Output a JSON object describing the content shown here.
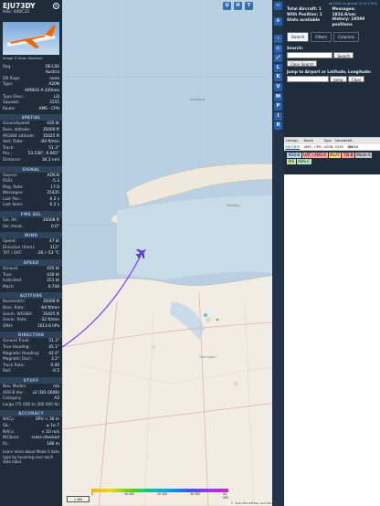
{
  "aircraft": {
    "callsign": "EJU73DY",
    "hex_line": "Hex: 440C33",
    "photo_credit": "Image © Brian Stoeman",
    "top_fields": [
      {
        "k": "Reg.:",
        "v": "OE-LSE"
      },
      {
        "k": "",
        "v": "Austria"
      },
      {
        "k": "DB flags:",
        "v": "none"
      },
      {
        "k": "Type:",
        "v": "A20N"
      },
      {
        "k": "",
        "v": "AIRBUS A-320neo"
      },
      {
        "k": "Type Desc.:",
        "v": "L2J"
      },
      {
        "k": "Squawk:",
        "v": "3155"
      },
      {
        "k": "Route:",
        "v": "AMS - CPH"
      }
    ],
    "sections": [
      {
        "title": "SPATIAL",
        "rows": [
          {
            "k": "Groundspeed:",
            "v": "435 kt"
          },
          {
            "k": "Baro. altitude:",
            "v": "35000 ft"
          },
          {
            "k": "WGS84 altitude:",
            "v": "35425 ft"
          },
          {
            "k": "Vert. Rate:",
            "v": "-64 ft/min"
          },
          {
            "k": "Track:",
            "v": "51.3°"
          },
          {
            "k": "Pos.:",
            "v": "53.530°, 6.665°"
          },
          {
            "k": "Distance:",
            "v": "34.3 nmi"
          }
        ]
      },
      {
        "title": "SIGNAL",
        "rows": [
          {
            "k": "Source:",
            "v": "ADS-B"
          },
          {
            "k": "RSSI:",
            "v": "-5.3"
          },
          {
            "k": "Msg. Rate:",
            "v": "17.0"
          },
          {
            "k": "Messages:",
            "v": "25435"
          },
          {
            "k": "Last Pos.:",
            "v": "0.2 s"
          },
          {
            "k": "Last Seen:",
            "v": "0.2 s"
          }
        ]
      },
      {
        "title": "FMS SEL",
        "rows": [
          {
            "k": "Sel. Alt.:",
            "v": "35008 ft"
          },
          {
            "k": "Sel. Head.:",
            "v": "0.0°"
          }
        ]
      },
      {
        "title": "WIND",
        "rows": [
          {
            "k": "Speed:",
            "v": "47 kt"
          },
          {
            "k": "Direction (from):",
            "v": "312°"
          },
          {
            "k": "TAT / OAT:",
            "v": "-26 / -53 °C"
          }
        ]
      },
      {
        "title": "SPEED",
        "rows": [
          {
            "k": "Ground:",
            "v": "435 kt"
          },
          {
            "k": "True:",
            "v": "430 kt"
          },
          {
            "k": "Indicated:",
            "v": "251 kt"
          },
          {
            "k": "Mach:",
            "v": "0.744"
          }
        ]
      },
      {
        "title": "ALTITUDE",
        "rows": [
          {
            "k": "Barometric:",
            "v": "35000 ft"
          },
          {
            "k": "Baro. Rate:",
            "v": "-64 ft/min"
          },
          {
            "k": "Geom. WGS84:",
            "v": "35425 ft"
          },
          {
            "k": "Geom. Rate:",
            "v": "-32 ft/min"
          },
          {
            "k": "QNH:",
            "v": "1013.6 hPa"
          }
        ]
      },
      {
        "title": "DIRECTION",
        "rows": [
          {
            "k": "Ground Track:",
            "v": "51.3°"
          },
          {
            "k": "True Heading:",
            "v": "45.1°"
          },
          {
            "k": "Magnetic Heading:",
            "v": "42.0°"
          },
          {
            "k": "Magnetic Decl.:",
            "v": "3.2°"
          },
          {
            "k": "Track Rate:",
            "v": "0.00"
          },
          {
            "k": "Roll:",
            "v": "-0.5"
          }
        ]
      },
      {
        "title": "STUFF",
        "rows": [
          {
            "k": "Nav. Modes:",
            "v": "n/a"
          },
          {
            "k": "ADS-B Ver.:",
            "v": "v2 (DO-260B)"
          },
          {
            "k": "Category:",
            "v": "A3"
          },
          {
            "k": "Large (75 000 to 300 000 lb)",
            "v": ""
          }
        ]
      },
      {
        "title": "ACCURACY",
        "rows": [
          {
            "k": "NACp:",
            "v": "EPU < 30 m"
          },
          {
            "k": "SIL:",
            "v": "≤ 1e-7"
          },
          {
            "k": "NACv:",
            "v": "< 10 m/s"
          },
          {
            "k": "NICbaro:",
            "v": "cross-checked"
          },
          {
            "k": "Rc:",
            "v": "186 m"
          }
        ]
      }
    ],
    "footer_note": "Learn more about Mode S data type by hovering over each data label."
  },
  "map": {
    "labels": {
      "sea1": "Ameland",
      "sea2": "Wadden",
      "city": "Groningen"
    },
    "buttons": [
      "U",
      "H",
      "T"
    ],
    "scale_label": "1 NM",
    "attribution": "© OpenStreetMap contributors.",
    "legend_ticks": [
      "0",
      "10 000",
      "20 000",
      "30 000",
      "40 000"
    ],
    "zoom_in": "+",
    "zoom_out": "−"
  },
  "toolbar": {
    "buttons": [
      "L",
      "K",
      "V",
      "M",
      "P",
      "I",
      "R"
    ]
  },
  "panel": {
    "link": "tar1090 on github (3.14.1700)",
    "total_aircraft": "Total Aircraft: 1",
    "with_position": "With Position: 1",
    "stats_available": "Stats available",
    "messages": "Messages: 1824.8/sec",
    "history": "History: 19599 positions",
    "tabs": [
      "Search",
      "Filters",
      "Columns"
    ],
    "search_label": "Search:",
    "search_button": "Search",
    "clear_search": "Clear Search",
    "jump_label": "Jump to Airport or Latitude, Longitude:",
    "jump_button": "Jump",
    "clear_button": "Clear",
    "table_headers": [
      "Callsign",
      "Route",
      "Type",
      "Squawk",
      "Alt. (ft)"
    ],
    "table_row": [
      "EJU73DY",
      "AMS - CPH",
      "A20N",
      "3155",
      "35000"
    ],
    "sources": [
      {
        "label": "ADS-B",
        "color": "#b6d5ff"
      },
      {
        "label": "UAT / ADS-R",
        "color": "#ff9f9f"
      },
      {
        "label": "MLAT",
        "color": "#ffd38a"
      },
      {
        "label": "TIS-B",
        "color": "#ff9f9f"
      },
      {
        "label": "Mode-S",
        "color": "#c8c8c8"
      },
      {
        "label": "AIS",
        "color": "#c8e6a4"
      },
      {
        "label": "ADS-C",
        "color": "#b6e8c4"
      }
    ]
  },
  "colors": {
    "track": "#7b3cf0",
    "aircraft": "#6a3bf5",
    "water": "#b6cfe2",
    "land": "#f0ede5",
    "panel": "#1f2c3b"
  }
}
